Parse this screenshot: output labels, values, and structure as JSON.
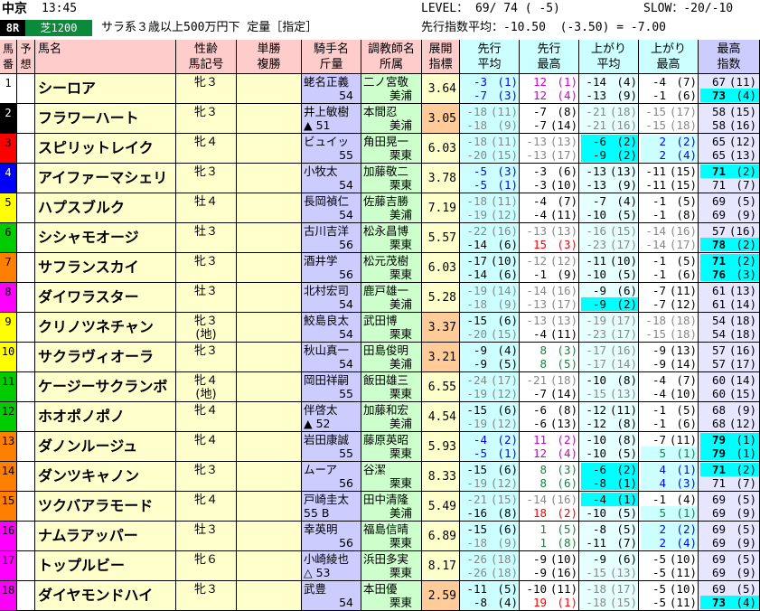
{
  "header": {
    "venue": "中京",
    "time": "13:45",
    "race_no": "8R",
    "surface": "芝1200",
    "race_condition": "サラ系３歳以上500万円下 定量［指定］",
    "level": "LEVEL： 69/ 74 ( -5)",
    "slow": "SLOW：-20/-10",
    "avg_index": "先行指数平均：-10.50  (-3.50) = -7.00"
  },
  "columns": {
    "umaban": "馬\n番",
    "yoso": "予\n想",
    "name": "馬名",
    "seirei": "性齢\n馬記号",
    "tansho": "単勝\n複勝",
    "jockey": "騎手名\n斤量",
    "trainer": "調教師名\n所属",
    "tenkai": "展開\n指標",
    "senko_avg": "先行\n平均",
    "senko_max": "先行\n最高",
    "agari_avg": "上がり\n平均",
    "agari_max": "上がり\n最高",
    "max_idx": "最高\n指数"
  },
  "colors": {
    "frame1": "#ffffff",
    "frame2": "#000000",
    "frame3": "#ff0000",
    "frame4": "#0000ff",
    "frame5": "#ffff00",
    "frame6": "#00cc00",
    "frame7": "#ff8000",
    "frame8": "#ff00ff"
  },
  "horses": [
    {
      "no": "1",
      "gate": "1",
      "name": "シーロア",
      "sex_age": "牝３",
      "jockey": "蛯名正義",
      "weight": "54",
      "trainer": "二ノ宮敬",
      "stable": "美浦",
      "tenkai": "3.64",
      "sa1": "-3",
      "sa1r": "(1)",
      "sa2": "-7",
      "sa2r": "(3)",
      "sm1": "12",
      "sm1r": "(1)",
      "sm2": "12",
      "sm2r": "(4)",
      "aa1": "-14",
      "aa1r": "(4)",
      "aa2": "-13",
      "aa2r": "(9)",
      "am1": "-4",
      "am1r": "(7)",
      "am2": "-1",
      "am2r": "(6)",
      "mx1": "67",
      "mx1r": "(11)",
      "mx2": "73",
      "mx2r": "(4)"
    },
    {
      "no": "2",
      "gate": "2",
      "name": "フラワーハート",
      "sex_age": "牝３",
      "jockey": "井上敏樹",
      "weight": "▲ 51",
      "trainer": "本間忍",
      "stable": "美浦",
      "tenkai": "3.05",
      "sa1": "-18",
      "sa1r": "(11)",
      "sa2": "-18",
      "sa2r": "(9)",
      "sm1": "-7",
      "sm1r": "(8)",
      "sm2": "-7",
      "sm2r": "(14)",
      "aa1": "-21",
      "aa1r": "(18)",
      "aa2": "-21",
      "aa2r": "(16)",
      "am1": "-15",
      "am1r": "(17)",
      "am2": "-15",
      "am2r": "(18)",
      "mx1": "58",
      "mx1r": "(15)",
      "mx2": "58",
      "mx2r": "(16)"
    },
    {
      "no": "3",
      "gate": "3",
      "name": "スピリットレイク",
      "sex_age": "牝４",
      "jockey": "ビュイッ",
      "weight": "55",
      "trainer": "角田晃一",
      "stable": "栗東",
      "tenkai": "6.03",
      "sa1": "-18",
      "sa1r": "(11)",
      "sa2": "-20",
      "sa2r": "(15)",
      "sm1": "-13",
      "sm1r": "(13)",
      "sm2": "-13",
      "sm2r": "(17)",
      "aa1": "-6",
      "aa1r": "(2)",
      "aa2": "-9",
      "aa2r": "(2)",
      "am1": "2",
      "am1r": "(2)",
      "am2": "2",
      "am2r": "(4)",
      "mx1": "65",
      "mx1r": "(12)",
      "mx2": "65",
      "mx2r": "(13)"
    },
    {
      "no": "4",
      "gate": "4",
      "name": "アイファーマシェリ",
      "sex_age": "牝３",
      "jockey": "小牧太",
      "weight": "54",
      "trainer": "加藤敬二",
      "stable": "栗東",
      "tenkai": "3.78",
      "sa1": "-5",
      "sa1r": "(3)",
      "sa2": "-5",
      "sa2r": "(1)",
      "sm1": "-3",
      "sm1r": "(6)",
      "sm2": "-3",
      "sm2r": "(10)",
      "aa1": "-13",
      "aa1r": "(13)",
      "aa2": "-13",
      "aa2r": "(9)",
      "am1": "-11",
      "am1r": "(15)",
      "am2": "-11",
      "am2r": "(15)",
      "mx1": "71",
      "mx1r": "(2)",
      "mx2": "71",
      "mx2r": "(7)"
    },
    {
      "no": "5",
      "gate": "5",
      "name": "ハプスブルク",
      "sex_age": "牡４",
      "jockey": "長岡禎仁",
      "weight": "54",
      "trainer": "佐藤吉勝",
      "stable": "美浦",
      "tenkai": "7.19",
      "sa1": "-18",
      "sa1r": "(11)",
      "sa2": "-19",
      "sa2r": "(12)",
      "sm1": "-4",
      "sm1r": "(7)",
      "sm2": "-4",
      "sm2r": "(11)",
      "aa1": "-7",
      "aa1r": "(4)",
      "aa2": "-10",
      "aa2r": "(5)",
      "am1": "-1",
      "am1r": "(5)",
      "am2": "-1",
      "am2r": "(8)",
      "mx1": "69",
      "mx1r": "(5)",
      "mx2": "69",
      "mx2r": "(9)"
    },
    {
      "no": "6",
      "gate": "6",
      "name": "シシャモオージ",
      "sex_age": "牡３",
      "jockey": "古川吉洋",
      "weight": "56",
      "trainer": "松永昌博",
      "stable": "栗東",
      "tenkai": "5.57",
      "sa1": "-22",
      "sa1r": "(16)",
      "sa2": "-14",
      "sa2r": "(6)",
      "sm1": "-13",
      "sm1r": "(13)",
      "sm2": "15",
      "sm2r": "(3)",
      "aa1": "-16",
      "aa1r": "(15)",
      "aa2": "-23",
      "aa2r": "(17)",
      "am1": "-14",
      "am1r": "(16)",
      "am2": "-14",
      "am2r": "(17)",
      "mx1": "57",
      "mx1r": "(16)",
      "mx2": "78",
      "mx2r": "(2)"
    },
    {
      "no": "7",
      "gate": "7",
      "name": "サフランスカイ",
      "sex_age": "牝３",
      "jockey": "酒井学",
      "weight": "56",
      "trainer": "松元茂樹",
      "stable": "栗東",
      "tenkai": "6.03",
      "sa1": "-17",
      "sa1r": "(10)",
      "sa2": "-14",
      "sa2r": "(6)",
      "sm1": "-12",
      "sm1r": "(12)",
      "sm2": "-1",
      "sm2r": "(9)",
      "aa1": "-11",
      "aa1r": "(10)",
      "aa2": "-10",
      "aa2r": "(5)",
      "am1": "-1",
      "am1r": "(5)",
      "am2": "-1",
      "am2r": "(6)",
      "mx1": "71",
      "mx1r": "(2)",
      "mx2": "76",
      "mx2r": "(3)"
    },
    {
      "no": "8",
      "gate": "8",
      "name": "ダイワラスター",
      "sex_age": "牡３",
      "jockey": "北村宏司",
      "weight": "54",
      "trainer": "鹿戸雄一",
      "stable": "美浦",
      "tenkai": "5.28",
      "sa1": "-19",
      "sa1r": "(14)",
      "sa2": "-18",
      "sa2r": "(9)",
      "sm1": "-14",
      "sm1r": "(16)",
      "sm2": "-13",
      "sm2r": "(17)",
      "aa1": "-9",
      "aa1r": "(6)",
      "aa2": "-9",
      "aa2r": "(2)",
      "am1": "-7",
      "am1r": "(11)",
      "am2": "-7",
      "am2r": "(12)",
      "mx1": "61",
      "mx1r": "(13)",
      "mx2": "61",
      "mx2r": "(14)"
    },
    {
      "no": "9",
      "gate": "5",
      "name": "クリノツネチャン",
      "sex_age": "牝３\n(地)",
      "jockey": "鮫島良太",
      "weight": "54",
      "trainer": "武田博",
      "stable": "栗東",
      "tenkai": "3.37",
      "sa1": "-15",
      "sa1r": "(6)",
      "sa2": "-20",
      "sa2r": "(15)",
      "sm1": "-13",
      "sm1r": "(13)",
      "sm2": "-4",
      "sm2r": "(11)",
      "aa1": "-19",
      "aa1r": "(17)",
      "aa2": "-23",
      "aa2r": "(17)",
      "am1": "-18",
      "am1r": "(18)",
      "am2": "-15",
      "am2r": "(18)",
      "mx1": "54",
      "mx1r": "(18)",
      "mx2": "54",
      "mx2r": "(18)"
    },
    {
      "no": "10",
      "gate": "5",
      "name": "サクラヴィオーラ",
      "sex_age": "牝３",
      "jockey": "秋山真一",
      "weight": "54",
      "trainer": "田島俊明",
      "stable": "美浦",
      "tenkai": "3.21",
      "sa1": "-9",
      "sa1r": "(4)",
      "sa2": "-9",
      "sa2r": "(5)",
      "sm1": "8",
      "sm1r": "(3)",
      "sm2": "8",
      "sm2r": "(5)",
      "aa1": "-17",
      "aa1r": "(16)",
      "aa2": "-17",
      "aa2r": "(14)",
      "am1": "-9",
      "am1r": "(13)",
      "am2": "-9",
      "am2r": "(14)",
      "mx1": "57",
      "mx1r": "(16)",
      "mx2": "57",
      "mx2r": "(17)"
    },
    {
      "no": "11",
      "gate": "6",
      "name": "ケージーサクランボ",
      "sex_age": "牝４\n(地)",
      "jockey": "岡田祥嗣",
      "weight": "55",
      "trainer": "飯田雄三",
      "stable": "栗東",
      "tenkai": "6.55",
      "sa1": "-24",
      "sa1r": "(17)",
      "sa2": "-19",
      "sa2r": "(12)",
      "sm1": "-21",
      "sm1r": "(18)",
      "sm2": "-7",
      "sm2r": "(14)",
      "aa1": "-10",
      "aa1r": "(8)",
      "aa2": "-15",
      "aa2r": "(13)",
      "am1": "-4",
      "am1r": "(7)",
      "am2": "-4",
      "am2r": "(10)",
      "mx1": "60",
      "mx1r": "(14)",
      "mx2": "60",
      "mx2r": "(15)"
    },
    {
      "no": "12",
      "gate": "6",
      "name": "ホオポノポノ",
      "sex_age": "牝４",
      "jockey": "伴啓太",
      "weight": "▲ 52",
      "trainer": "加藤和宏",
      "stable": "美浦",
      "tenkai": "4.54",
      "sa1": "-15",
      "sa1r": "(6)",
      "sa2": "-19",
      "sa2r": "(12)",
      "sm1": "-6",
      "sm1r": "(8)",
      "sm2": "-6",
      "sm2r": "(13)",
      "aa1": "-12",
      "aa1r": "(11)",
      "aa2": "-12",
      "aa2r": "(8)",
      "am1": "-1",
      "am1r": "(5)",
      "am2": "-1",
      "am2r": "(6)",
      "mx1": "68",
      "mx1r": "(9)",
      "mx2": "68",
      "mx2r": "(12)"
    },
    {
      "no": "13",
      "gate": "7",
      "name": "ダノンルージュ",
      "sex_age": "牝４",
      "jockey": "岩田康誠",
      "weight": "55",
      "trainer": "藤原英昭",
      "stable": "栗東",
      "tenkai": "5.93",
      "sa1": "-4",
      "sa1r": "(2)",
      "sa2": "-5",
      "sa2r": "(1)",
      "sm1": "11",
      "sm1r": "(2)",
      "sm2": "12",
      "sm2r": "(4)",
      "aa1": "-10",
      "aa1r": "(8)",
      "aa2": "-10",
      "aa2r": "(5)",
      "am1": "-7",
      "am1r": "(11)",
      "am2": "5",
      "am2r": "(1)",
      "mx1": "79",
      "mx1r": "(1)",
      "mx2": "79",
      "mx2r": "(1)"
    },
    {
      "no": "14",
      "gate": "7",
      "name": "ダンツキャノン",
      "sex_age": "牝３",
      "jockey": "ムーア",
      "weight": "56",
      "trainer": "谷潔",
      "stable": "栗東",
      "tenkai": "8.33",
      "sa1": "-15",
      "sa1r": "(6)",
      "sa2": "-19",
      "sa2r": "(12)",
      "sm1": "8",
      "sm1r": "(3)",
      "sm2": "8",
      "sm2r": "(6)",
      "aa1": "-6",
      "aa1r": "(2)",
      "aa2": "-8",
      "aa2r": "(1)",
      "am1": "4",
      "am1r": "(1)",
      "am2": "4",
      "am2r": "(3)",
      "mx1": "71",
      "mx1r": "(2)",
      "mx2": "71",
      "mx2r": "(7)"
    },
    {
      "no": "15",
      "gate": "7",
      "name": "ツクバアラモード",
      "sex_age": "牝４",
      "jockey": "戸崎圭太",
      "weight": "55 B",
      "trainer": "田中清隆",
      "stable": "美浦",
      "tenkai": "5.49",
      "sa1": "-21",
      "sa1r": "(15)",
      "sa2": "-16",
      "sa2r": "(8)",
      "sm1": "-14",
      "sm1r": "(16)",
      "sm2": "18",
      "sm2r": "(2)",
      "aa1": "-4",
      "aa1r": "(1)",
      "aa2": "-10",
      "aa2r": "(5)",
      "am1": "-1",
      "am1r": "(4)",
      "am2": "5",
      "am2r": "(1)",
      "mx1": "69",
      "mx1r": "(5)",
      "mx2": "69",
      "mx2r": "(9)"
    },
    {
      "no": "16",
      "gate": "8",
      "name": "ナムラアッパー",
      "sex_age": "牡３",
      "jockey": "幸英明",
      "weight": "56",
      "trainer": "福島信晴",
      "stable": "栗東",
      "tenkai": "6.89",
      "sa1": "-15",
      "sa1r": "(6)",
      "sa2": "-18",
      "sa2r": "(9)",
      "sm1": "1",
      "sm1r": "(5)",
      "sm2": "1",
      "sm2r": "(8)",
      "aa1": "-8",
      "aa1r": "(5)",
      "aa2": "-11",
      "aa2r": "(7)",
      "am1": "2",
      "am1r": "(2)",
      "am2": "2",
      "am2r": "(4)",
      "mx1": "69",
      "mx1r": "(5)",
      "mx2": "69",
      "mx2r": "(9)"
    },
    {
      "no": "17",
      "gate": "8",
      "name": "トップルビー",
      "sex_age": "牝６",
      "jockey": "小崎綾也",
      "weight": "△ 53",
      "trainer": "浜田多実",
      "stable": "栗東",
      "tenkai": "8.17",
      "sa1": "-26",
      "sa1r": "(18)",
      "sa2": "-26",
      "sa2r": "(18)",
      "sm1": "-9",
      "sm1r": "(10)",
      "sm2": "-9",
      "sm2r": "(16)",
      "aa1": "-9",
      "aa1r": "(6)",
      "aa2": "-15",
      "aa2r": "(13)",
      "am1": "-5",
      "am1r": "(10)",
      "am2": "-5",
      "am2r": "(11)",
      "mx1": "69",
      "mx1r": "(5)",
      "mx2": "69",
      "mx2r": "(9)"
    },
    {
      "no": "18",
      "gate": "8",
      "name": "ダイヤモンドハイ",
      "sex_age": "牝３",
      "jockey": "武豊",
      "weight": "54",
      "trainer": "本田優",
      "stable": "栗東",
      "tenkai": "2.59",
      "sa1": "-11",
      "sa1r": "(5)",
      "sa2": "-8",
      "sa2r": "(4)",
      "sm1": "-10",
      "sm1r": "(11)",
      "sm2": "19",
      "sm2r": "(1)",
      "aa1": "-18",
      "aa1r": "(17)",
      "aa2": "-18",
      "aa2r": "(15)",
      "am1": "-5",
      "am1r": "(10)",
      "am2": "-5",
      "am2r": "(11)",
      "mx1": "69",
      "mx1r": "(5)",
      "mx2": "73",
      "mx2r": "(4)"
    }
  ]
}
